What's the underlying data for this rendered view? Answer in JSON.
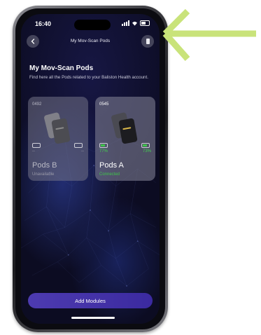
{
  "status_bar": {
    "time": "16:40"
  },
  "nav": {
    "title": "My Mov-Scan Pods",
    "back_icon": "chevron-left-icon",
    "pods_icon": "pod-device-icon"
  },
  "page": {
    "heading": "My Mov-Scan Pods",
    "description": "Find here all the Pods related to your Baliston Health account."
  },
  "pods": [
    {
      "id": "0492",
      "name": "Pods B",
      "status": "Unavailable",
      "battery_left": "--",
      "battery_right": "--"
    },
    {
      "id": "0545",
      "name": "Pods A",
      "status": "Connected",
      "battery_left": "77%",
      "battery_right": "73%"
    }
  ],
  "footer": {
    "add_button_label": "Add Modules"
  },
  "colors": {
    "accent_green": "#3fc64a",
    "arrow_green": "#c9e37a",
    "button_purple": "#4d3bb0"
  }
}
